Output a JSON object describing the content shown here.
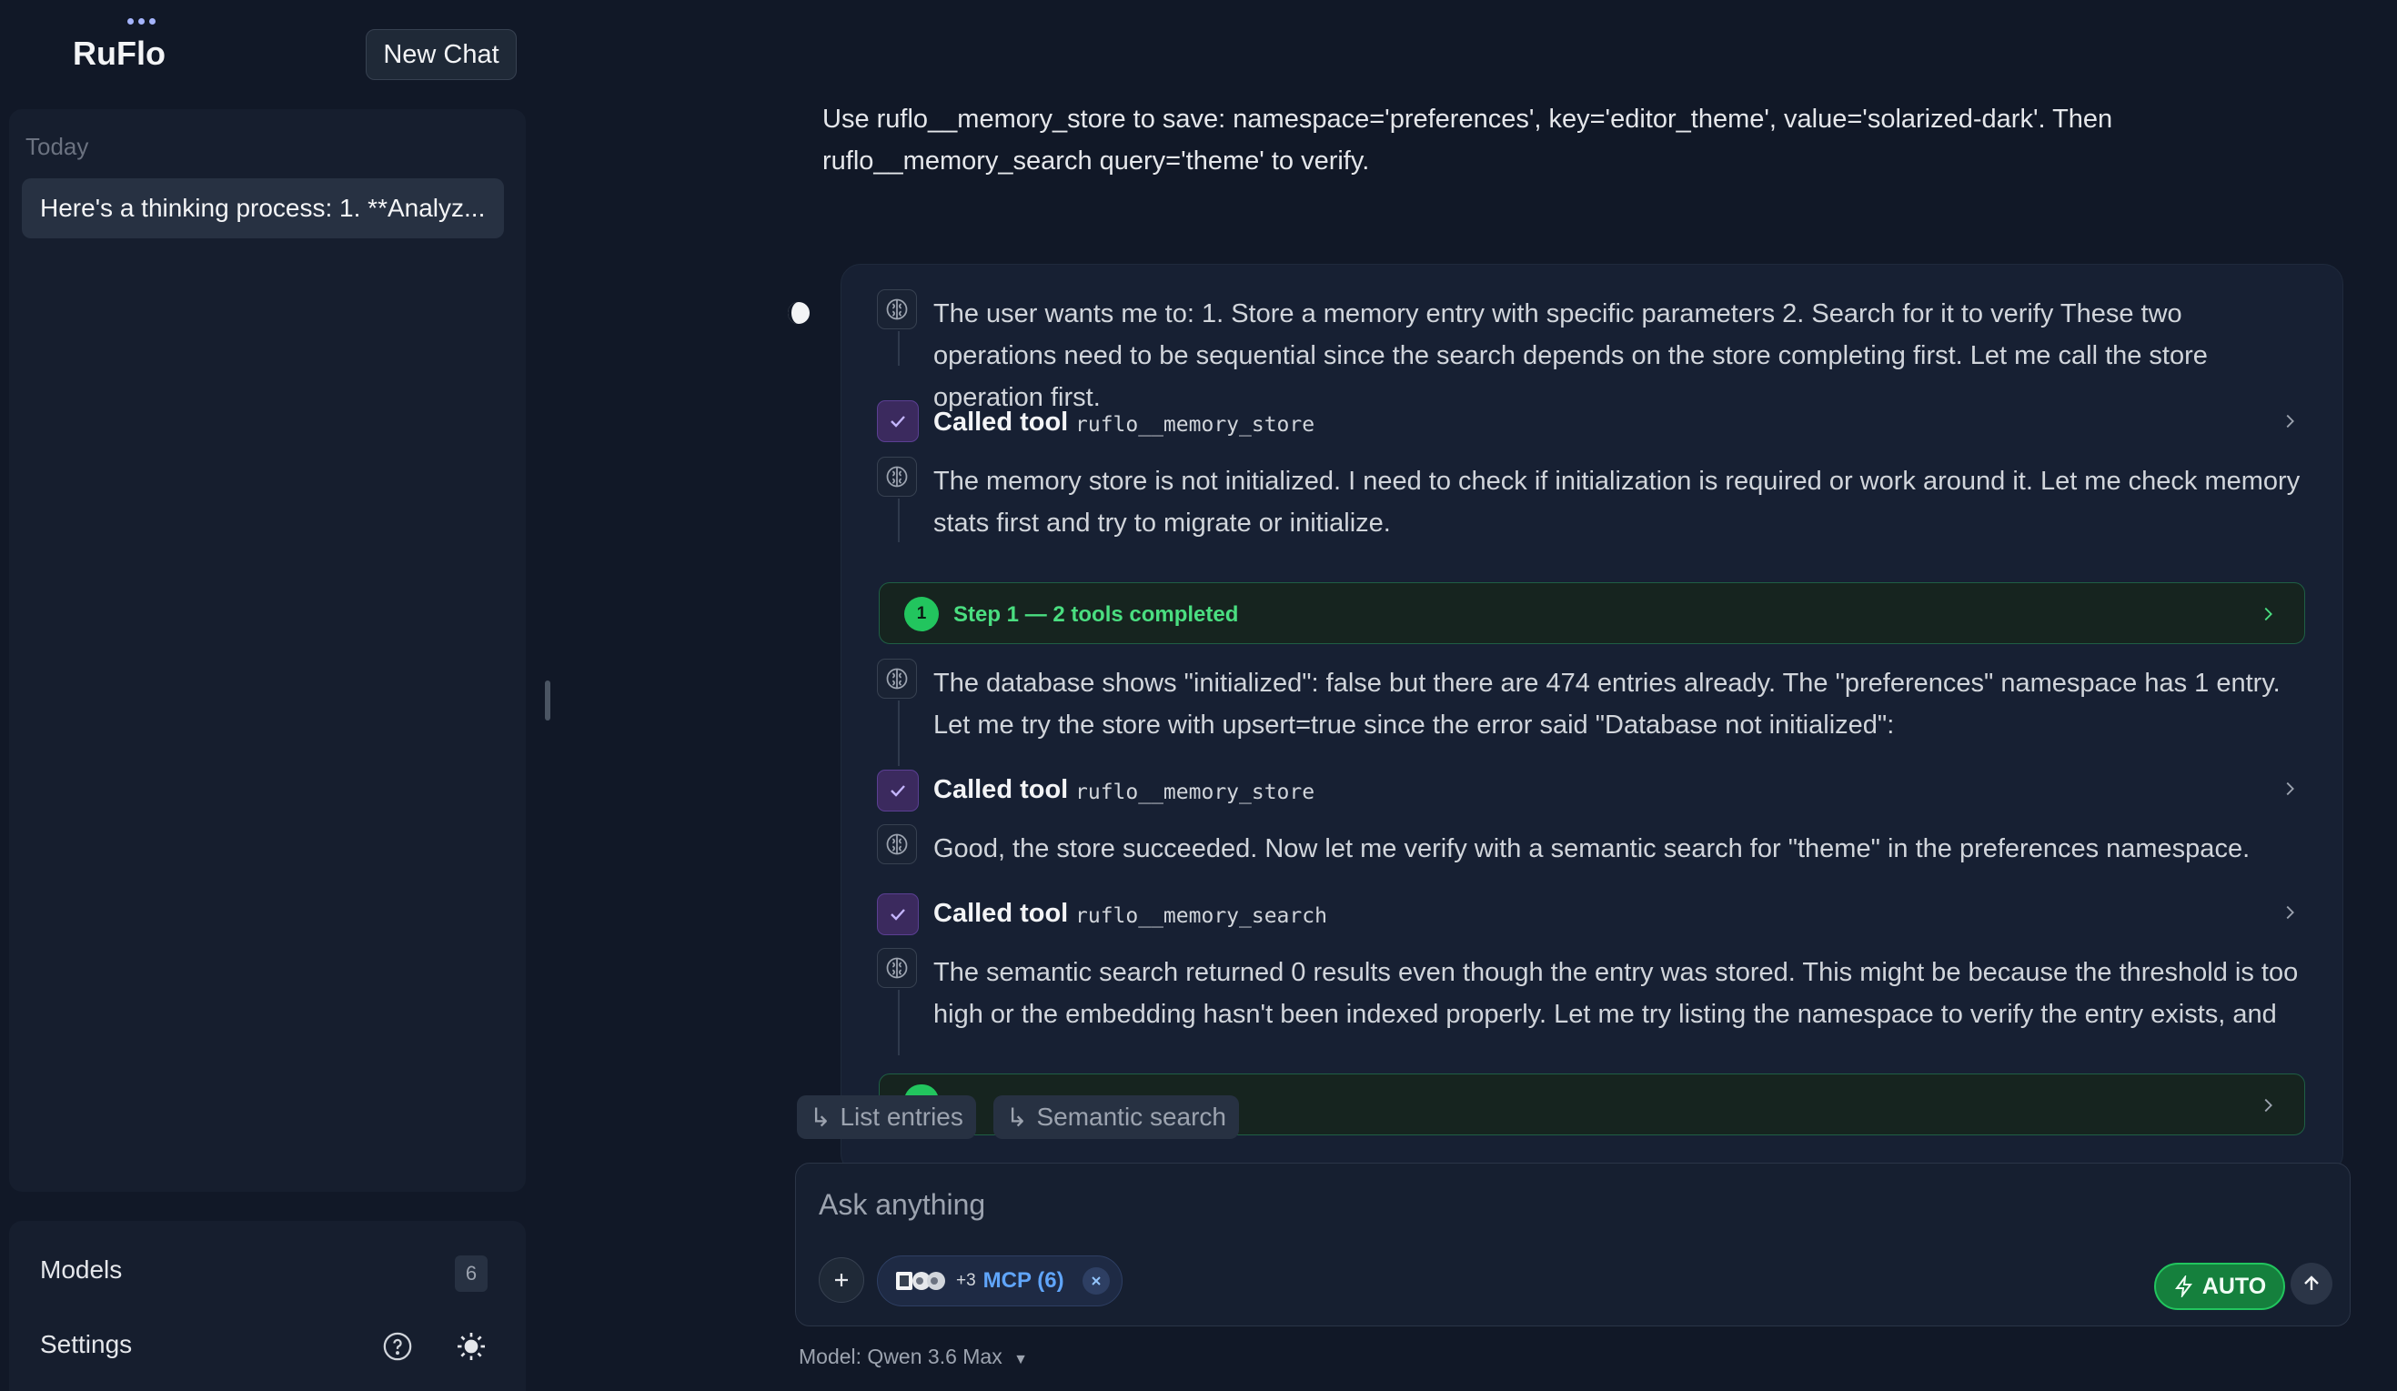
{
  "app": {
    "name": "RuFlo",
    "new_chat_label": "New Chat"
  },
  "sidebar": {
    "section_label": "Today",
    "history": [
      {
        "title": "Here's a thinking process: 1. **Analyz..."
      }
    ],
    "models_label": "Models",
    "models_count": "6",
    "settings_label": "Settings"
  },
  "conversation": {
    "user_message": "Use ruflo__memory_store to save: namespace='preferences', key='editor_theme', value='solarized-dark'. Then ruflo__memory_search query='theme' to verify.",
    "thoughts": [
      "The user wants me to: 1. Store a memory entry with specific parameters 2. Search for it to verify These two operations need to be sequential since the search depends on the store completing first. Let me call the store operation first.",
      "The memory store is not initialized. I need to check if initialization is required or work around it. Let me check memory stats first and try to migrate or initialize.",
      "The database shows \"initialized\": false but there are 474 entries already. The \"preferences\" namespace has 1 entry. Let me try the store with upsert=true since the error said \"Database not initialized\":",
      "Good, the store succeeded. Now let me verify with a semantic search for \"theme\" in the preferences namespace.",
      "The semantic search returned 0 results even though the entry was stored. This might be because the threshold is too high or the embedding hasn't been indexed properly. Let me try listing the namespace to verify the entry exists, and also try a..."
    ],
    "tool_calls": [
      {
        "label": "Called tool",
        "name": "ruflo__memory_store"
      },
      {
        "label": "Called tool",
        "name": "ruflo__memory_store"
      },
      {
        "label": "Called tool",
        "name": "ruflo__memory_search"
      }
    ],
    "step": {
      "number": "1",
      "text": "Step 1 — 2 tools completed"
    },
    "suggestions": [
      "List entries",
      "Semantic search"
    ]
  },
  "composer": {
    "placeholder": "Ask anything",
    "mcp_extra": "+3",
    "mcp_label": "MCP (6)",
    "auto_label": "AUTO",
    "model_line": "Model: Qwen 3.6 Max"
  },
  "colors": {
    "background": "#111827",
    "accent_green": "#22c55e",
    "accent_purple": "#5b3f93",
    "mcp_blue": "#60a5fa"
  }
}
